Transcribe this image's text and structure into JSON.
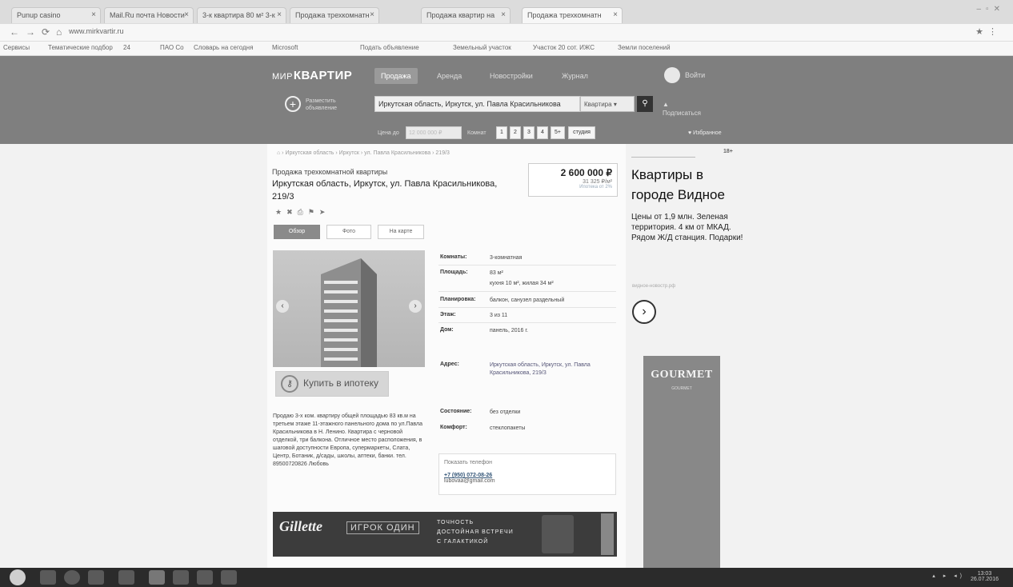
{
  "browser": {
    "tabs": [
      {
        "label": "Punup casino"
      },
      {
        "label": "Mail.Ru почта Новости"
      },
      {
        "label": "3-к квартира 80 м² 3-к"
      },
      {
        "label": "Продажа трехкомнатн"
      },
      {
        "label": "Продажа квартир на"
      },
      {
        "label": "Продажа трехкомнатн"
      }
    ],
    "url": "www.mirkvartir.ru",
    "bookmarks": [
      "Сервисы",
      "Тематические подбор",
      "24",
      "ПАО Со",
      "Словарь на сегодня",
      "Microsoft",
      "Подать объявление",
      "Земельный участок",
      "Участок 20 сот. ИЖС",
      "Земли поселений"
    ]
  },
  "header": {
    "logo_bold": "МИР",
    "logo_rest": "КВАРТИР",
    "nav": [
      {
        "label": "Продажа"
      },
      {
        "label": "Аренда"
      },
      {
        "label": "Новостройки"
      },
      {
        "label": "Журнал"
      }
    ],
    "user": "Войти",
    "add_label": "Разместить объявление",
    "search_value": "Иркутская область, Иркутск, ул. Павла Красильникова",
    "type_select": "Квартира",
    "subscribe": "Подписаться",
    "price_label": "Цена до",
    "price_placeholder": "12 000 000 ₽",
    "rooms_label": "Комнат",
    "rooms": [
      "1",
      "2",
      "3",
      "4",
      "5+"
    ],
    "studio": "студия",
    "favorites": "Избранное"
  },
  "breadcrumb": "Иркутская область › Иркутск › ул. Павла Красильникова › 219/3",
  "listing": {
    "subtitle": "Продажа трехкомнатной квартиры",
    "address": "Иркутская область, Иркутск, ул. Павла Красильникова, 219/3",
    "price": "2 600 000 ₽",
    "price_per_m": "31 325 ₽/м²",
    "price_note": "Ипотека от 2%",
    "actions": [
      "★",
      "✖",
      "⎙",
      "⚑",
      "➤"
    ],
    "photo_tabs": [
      "Обзор",
      "Фото",
      "На карте"
    ],
    "buy_button": "Купить в ипотеку",
    "description": "Продаю 3-х ком. квартиру общей площадью 83 кв.м на третьем этаже 11-этажного панельного дома по ул.Павла Красильникова в Н. Ленино. Квартира с черновой отделкой, три балкона. Отличное место расположения, в шаговой доступности Европа, супермаркеты, Слата, Центр, Ботаник, д/сады, школы, аптеки, банки. тел. 89500720826 Любовь",
    "details": [
      {
        "label": "Комнаты:",
        "value": "3-комнатная"
      },
      {
        "label": "Площадь:",
        "value": "83 м²",
        "value2": "кухня 10 м², жилая 34 м²"
      },
      {
        "label": "Планировка:",
        "value": "балкон, санузел раздельный"
      },
      {
        "label": "Этаж:",
        "value": "3 из 11"
      },
      {
        "label": "Дом:",
        "value": "панель, 2016 г."
      },
      {
        "label": "Адрес:",
        "value": "Иркутская область, Иркутск, ул. Павла Красильникова, 219/3"
      },
      {
        "label": "Состояние:",
        "value": "без отделки"
      },
      {
        "label": "Комфорт:",
        "value": "стеклопакеты"
      }
    ],
    "contact_header": "Показать телефон",
    "contact_phone": "+7 (950) 072-08-26",
    "contact_email": "lubovaa@gmail.com"
  },
  "banner": {
    "brand": "Gillette",
    "middle": "ИГРОК ОДИН",
    "lines": [
      "ТОЧНОСТЬ",
      "ДОСТОЙНАЯ ВСТРЕЧИ",
      "С ГАЛАКТИКОЙ"
    ]
  },
  "right_ad": {
    "tag": "18+",
    "title": "Квартиры в городе Видное",
    "text": "Цены от 1,9 млн. Зеленая территория. 4 км от МКАД. Рядом Ж/Д станция. Подарки!",
    "url": "видное-новостр.рф",
    "next_icon": "›",
    "gourmet_brand": "GOURMET",
    "gourmet_sub": "GOURMET"
  },
  "taskbar": {
    "clock_time": "13:03",
    "clock_date": "26.07.2016"
  }
}
